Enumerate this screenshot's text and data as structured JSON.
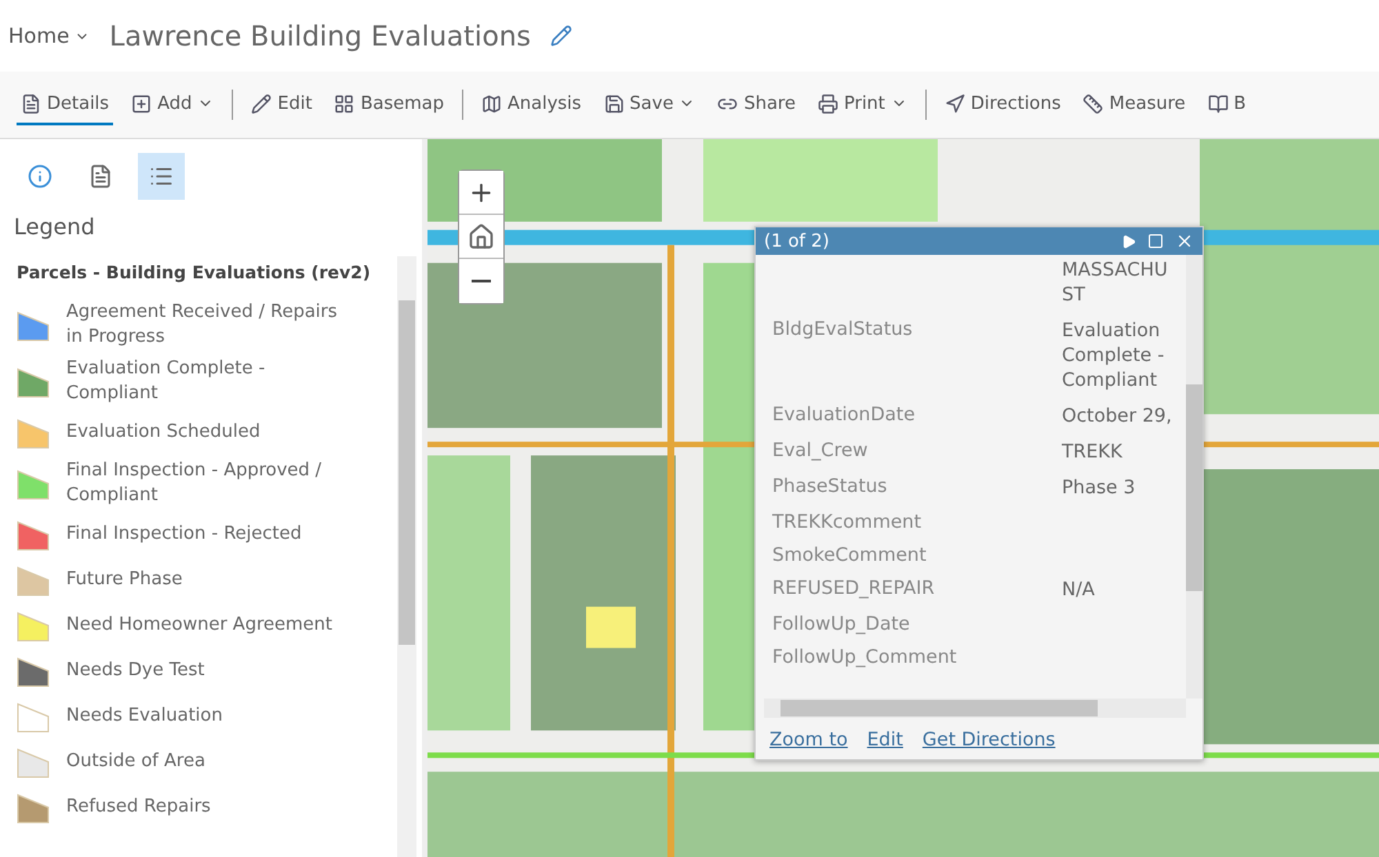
{
  "header": {
    "home": "Home",
    "title": "Lawrence Building Evaluations"
  },
  "toolbar": [
    {
      "kind": "button",
      "label": "Details",
      "selected": true,
      "dropdown": false
    },
    {
      "kind": "button",
      "label": "Add",
      "selected": false,
      "dropdown": true
    },
    {
      "kind": "divider"
    },
    {
      "kind": "button",
      "label": "Edit",
      "selected": false,
      "dropdown": false
    },
    {
      "kind": "button",
      "label": "Basemap",
      "selected": false,
      "dropdown": false
    },
    {
      "kind": "divider"
    },
    {
      "kind": "button",
      "label": "Analysis",
      "selected": false,
      "dropdown": false
    },
    {
      "kind": "button",
      "label": "Save",
      "selected": false,
      "dropdown": true
    },
    {
      "kind": "button",
      "label": "Share",
      "selected": false,
      "dropdown": false
    },
    {
      "kind": "button",
      "label": "Print",
      "selected": false,
      "dropdown": true
    },
    {
      "kind": "divider"
    },
    {
      "kind": "button",
      "label": "Directions",
      "selected": false,
      "dropdown": false
    },
    {
      "kind": "button",
      "label": "Measure",
      "selected": false,
      "dropdown": false
    },
    {
      "kind": "button",
      "label": "B",
      "selected": false,
      "dropdown": false
    }
  ],
  "sidebar": {
    "tabs": [
      {
        "selected": false
      },
      {
        "selected": false
      },
      {
        "selected": true
      }
    ],
    "heading": "Legend",
    "layer": "Parcels - Building Evaluations (rev2)",
    "legend": [
      {
        "label": "Agreement Received / Repairs in Progress",
        "color": "#5b9bf0"
      },
      {
        "label": "Evaluation Complete - Compliant",
        "color": "#6fa866"
      },
      {
        "label": "Evaluation Scheduled",
        "color": "#f7c56b"
      },
      {
        "label": "Final Inspection - Approved / Compliant",
        "color": "#7fe06a"
      },
      {
        "label": "Final Inspection - Rejected",
        "color": "#f06262"
      },
      {
        "label": "Future Phase",
        "color": "#ddc6a2"
      },
      {
        "label": "Need Homeowner Agreement",
        "color": "#f5f060"
      },
      {
        "label": "Needs Dye Test",
        "color": "#6b6b6b"
      },
      {
        "label": "Needs Evaluation",
        "color": "#ffffff"
      },
      {
        "label": "Outside of Area",
        "color": "#e8e8e8"
      },
      {
        "label": "Refused Repairs",
        "color": "#b59a70"
      }
    ]
  },
  "popup": {
    "title": "(1 of 2)",
    "rows": [
      {
        "value": "MASSACHU ST"
      },
      {
        "field": "BldgEvalStatus",
        "value": "Evaluation Complete - Compliant"
      },
      {
        "field": "EvaluationDate",
        "value": "October 29,"
      },
      {
        "field": "Eval_Crew",
        "value": "TREKK"
      },
      {
        "field": "PhaseStatus",
        "value": "Phase 3"
      },
      {
        "field": "TREKKcomment"
      },
      {
        "field": "SmokeComment"
      },
      {
        "field": "REFUSED_REPAIR",
        "value": "N/A"
      },
      {
        "field": "FollowUp_Date"
      },
      {
        "field": "FollowUp_Comment"
      }
    ],
    "links": [
      "Zoom to",
      "Edit",
      "Get Directions"
    ]
  }
}
